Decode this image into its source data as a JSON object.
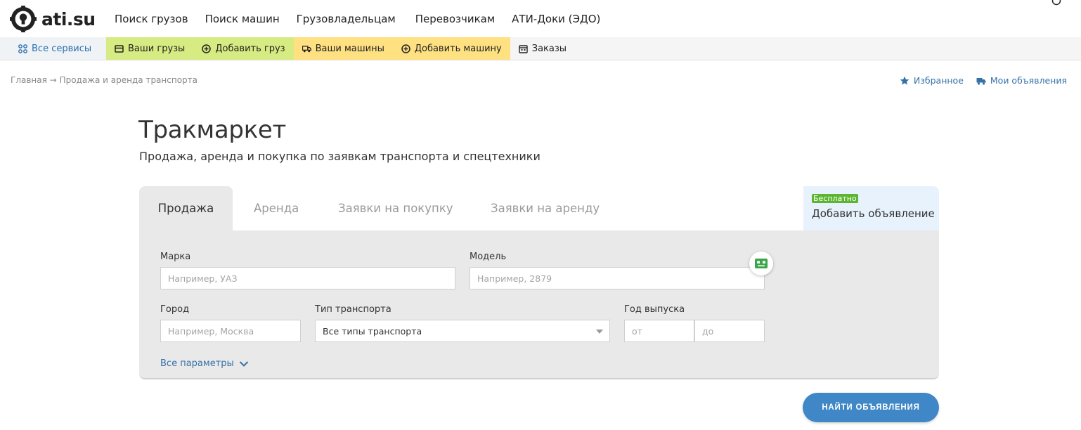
{
  "header": {
    "brand": "ati.su",
    "nav": [
      "Поиск грузов",
      "Поиск машин",
      "Грузовладельцам",
      "Перевозчикам",
      "АТИ-Доки (ЭДО)"
    ]
  },
  "services": {
    "all": "Все сервисы",
    "your_cargo": "Ваши грузы",
    "add_cargo": "Добавить груз",
    "your_trucks": "Ваши машины",
    "add_truck": "Добавить машину",
    "orders": "Заказы"
  },
  "breadcrumb": {
    "home": "Главная",
    "separator": "→",
    "current": "Продажа и аренда транспорта"
  },
  "right_links": {
    "favorites": "Избранное",
    "my_ads": "Мои объявления"
  },
  "page": {
    "title": "Тракмаркет",
    "subtitle": "Продажа, аренда и покупка по заявкам транспорта и спецтехники"
  },
  "tabs": [
    "Продажа",
    "Аренда",
    "Заявки на покупку",
    "Заявки на аренду"
  ],
  "active_tab": "Продажа",
  "add_ad": {
    "badge": "Бесплатно",
    "label": "Добавить объявление"
  },
  "form": {
    "brand_label": "Марка",
    "brand_placeholder": "Например, УАЗ",
    "model_label": "Модель",
    "model_placeholder": "Например, 2879",
    "city_label": "Город",
    "city_placeholder": "Например, Москва",
    "type_label": "Тип транспорта",
    "type_value": "Все типы транспорта",
    "year_label": "Год выпуска",
    "year_from_placeholder": "от",
    "year_to_placeholder": "до",
    "all_params": "Все параметры"
  },
  "search_button": "НАЙТИ ОБЪЯВЛЕНИЯ",
  "colors": {
    "green_service": "#d6ec82",
    "yellow_service": "#ffe182",
    "link_blue": "#3571a8",
    "button_blue": "#3f87c6",
    "badge_green": "#5cb531"
  }
}
